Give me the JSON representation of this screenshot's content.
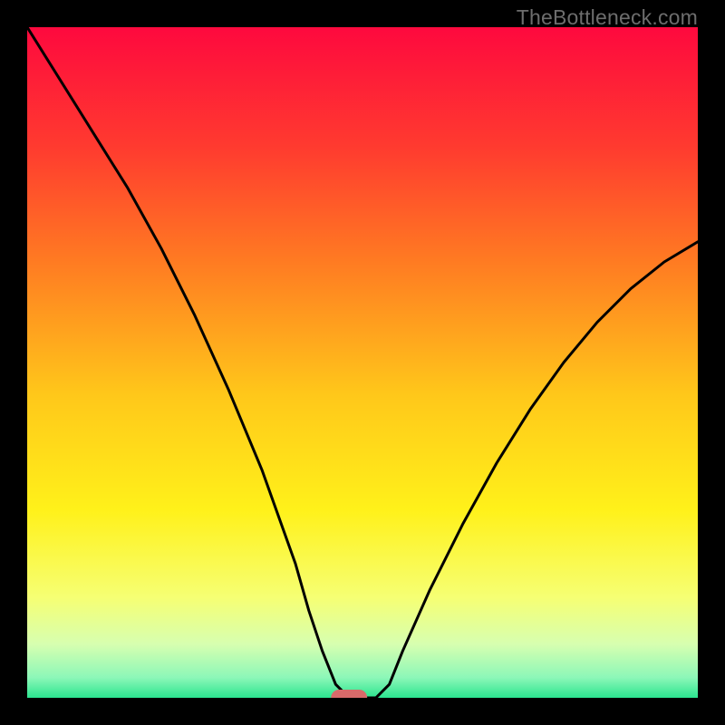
{
  "watermark": "TheBottleneck.com",
  "chart_data": {
    "type": "line",
    "title": "",
    "xlabel": "",
    "ylabel": "",
    "xlim": [
      0,
      100
    ],
    "ylim": [
      0,
      100
    ],
    "x": [
      0,
      5,
      10,
      15,
      20,
      25,
      30,
      35,
      40,
      42,
      44,
      46,
      48,
      50,
      52,
      54,
      56,
      60,
      65,
      70,
      75,
      80,
      85,
      90,
      95,
      100
    ],
    "values": [
      100,
      92,
      84,
      76,
      67,
      57,
      46,
      34,
      20,
      13,
      7,
      2,
      0,
      0,
      0,
      2,
      7,
      16,
      26,
      35,
      43,
      50,
      56,
      61,
      65,
      68
    ],
    "series": [
      {
        "name": "bottleneck-curve",
        "x_ref": "x",
        "y_ref": "values"
      }
    ],
    "marker": {
      "x": 48,
      "y": 0,
      "color": "#d86a6a"
    },
    "background_gradient": {
      "stops": [
        {
          "offset": 0.0,
          "color": "#fe093e"
        },
        {
          "offset": 0.18,
          "color": "#ff3b2f"
        },
        {
          "offset": 0.35,
          "color": "#ff7b22"
        },
        {
          "offset": 0.55,
          "color": "#ffc81a"
        },
        {
          "offset": 0.72,
          "color": "#fff11a"
        },
        {
          "offset": 0.85,
          "color": "#f6ff73"
        },
        {
          "offset": 0.92,
          "color": "#d7ffb0"
        },
        {
          "offset": 0.97,
          "color": "#8cf7b8"
        },
        {
          "offset": 1.0,
          "color": "#2be58f"
        }
      ]
    }
  }
}
